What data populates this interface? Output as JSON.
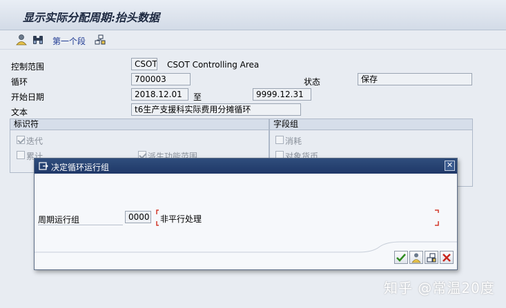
{
  "window": {
    "title": "显示实际分配周期:抬头数据"
  },
  "toolbar": {
    "first_segment_label": "第一个段"
  },
  "header_fields": {
    "controlling_area_label": "控制范围",
    "controlling_area_value": "CSOT",
    "controlling_area_desc": "CSOT Controlling Area",
    "cycle_label": "循环",
    "cycle_value": "700003",
    "status_label": "状态",
    "status_value": "保存",
    "start_date_label": "开始日期",
    "start_date_value": "2018.12.01",
    "to_label": "至",
    "end_date_value": "9999.12.31",
    "text_label": "文本",
    "text_value": "t6生产支援科实际费用分摊循环"
  },
  "indicator_group": {
    "title": "标识符",
    "iterative_label": "迭代",
    "iterative_checked": true,
    "cumulative_label": "累计",
    "cumulative_checked": false,
    "derived_label": "派生功能范围",
    "derived_checked": true
  },
  "field_group": {
    "title": "字段组",
    "consumption_label": "消耗",
    "consumption_checked": false,
    "object_currency_label": "对象货币",
    "object_currency_checked": false
  },
  "dialog": {
    "title": "决定循环运行组",
    "period_run_group_label": "周期运行组",
    "period_run_group_value": "0000",
    "period_run_group_text": "非平行处理",
    "buttons": [
      "confirm",
      "person",
      "copy",
      "cancel"
    ]
  },
  "watermark": {
    "text": "知乎 @常温20度"
  },
  "colors": {
    "dialog_title_bg": "#1f3868",
    "confirm_green": "#2e8b1e",
    "cancel_red": "#c8261c",
    "required_marker": "#d2382b"
  }
}
